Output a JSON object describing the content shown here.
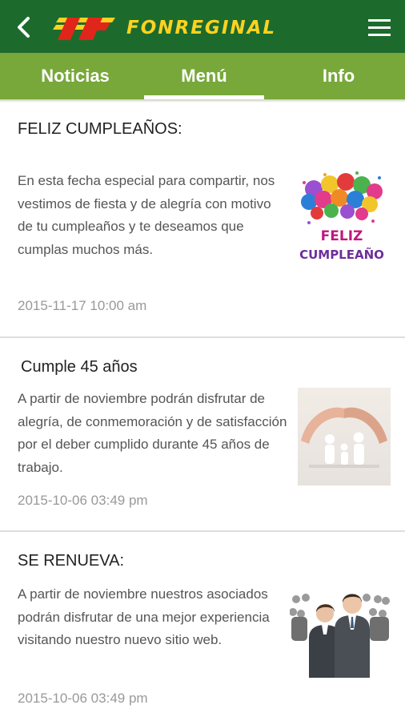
{
  "app": {
    "brand": "FONREGINAL",
    "back_icon": "back-arrow-icon",
    "menu_icon": "hamburger-menu-icon",
    "colors": {
      "appbar": "#1c6b2d",
      "tabbar": "#78a83a",
      "logo_yellow": "#ffd21f",
      "logo_red": "#e0251b"
    }
  },
  "tabs": [
    {
      "label": "Noticias"
    },
    {
      "label": "Menú",
      "active": true
    },
    {
      "label": "Info"
    }
  ],
  "posts": [
    {
      "title": "FELIZ CUMPLEAÑOS:",
      "body": "En esta fecha especial para compartir, nos vestimos de fiesta y de alegría con motivo de tu cumpleaños y te deseamos que cumplas muchos más.",
      "date": "2015-11-17 10:00 am",
      "image_text_1": "FELIZ",
      "image_text_2": "CUMPLEAÑO"
    },
    {
      "title": "Cumple 45 años",
      "body": "A partir de noviembre podrán disfrutar de alegría, de conmemoración y de satisfacción por el deber cumplido durante 45 años de trabajo.",
      "date": "2015-10-06 03:49 pm"
    },
    {
      "title": "SE RENUEVA:",
      "body": "A partir de noviembre nuestros asociados podrán disfrutar de una mejor experiencia visitando nuestro nuevo sitio web.",
      "date": "2015-10-06 03:49 pm"
    }
  ]
}
